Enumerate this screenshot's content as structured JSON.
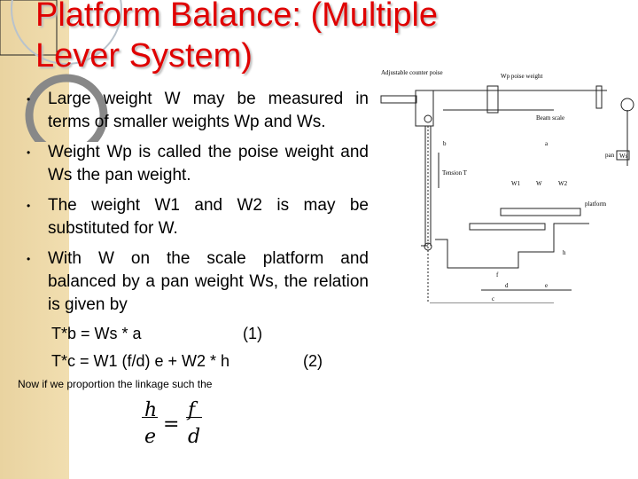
{
  "title": {
    "line1": "Platform Balance: (Multiple",
    "line2": "Lever System)"
  },
  "bullets": [
    {
      "text": "Large weight W may be measured in terms of smaller weights Wp and Ws."
    },
    {
      "text": "Weight Wp is called the poise weight and Ws the pan weight."
    },
    {
      "text": "The weight W1 and W2 is may be substituted for W."
    },
    {
      "text": "With W on the scale platform and balanced by a pan weight Ws, the relation is given by"
    }
  ],
  "equations": [
    {
      "expr": "T*b = Ws * a",
      "num": "(1)"
    },
    {
      "expr": "T*c = W1 (f/d) e + W2 * h",
      "num": "(2)"
    }
  ],
  "note": "Now if we proportion the linkage such the",
  "fraction": {
    "left_num": "h",
    "left_den": "e",
    "eq": "=",
    "right_num": "f",
    "right_den": "d"
  },
  "diagram": {
    "labels": {
      "counter": "Adjustable counter poise",
      "poise": "Wp poise weight",
      "beam": "Beam scale",
      "b": "b",
      "a": "a",
      "pan": "pan",
      "ws": "Ws",
      "tension": "Tension T",
      "w1": "W1",
      "w": "W",
      "w2": "W2",
      "platform": "platform",
      "h": "h",
      "f": "f",
      "d": "d",
      "e": "e",
      "c": "c"
    }
  },
  "colors": {
    "title": "#e00000",
    "strip": "#ecd6a4"
  }
}
